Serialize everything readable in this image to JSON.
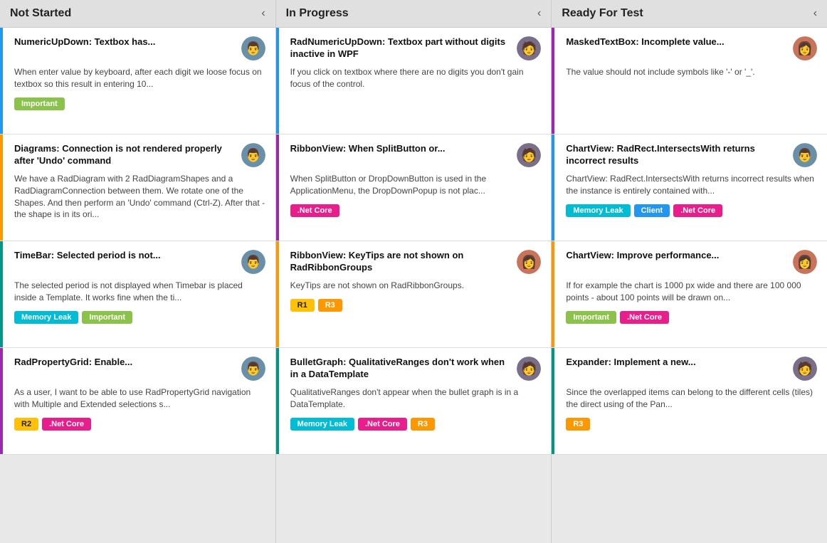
{
  "columns": [
    {
      "id": "not-started",
      "title": "Not Started",
      "arrow": "‹",
      "cards": [
        {
          "id": "card-1",
          "title": "NumericUpDown: Textbox has...",
          "body": "When enter value by keyboard, after each digit we loose focus on textbox so this result in entering 10...",
          "avatar": "m",
          "bar": "blue",
          "tags": [
            {
              "label": "Important",
              "type": "important"
            }
          ]
        },
        {
          "id": "card-2",
          "title": "Diagrams: Connection is not rendered properly after 'Undo' command",
          "body": "We have a RadDiagram with 2 RadDiagramShapes and a RadDiagramConnection between them. We rotate one of the Shapes. And then perform an 'Undo' command (Ctrl-Z). After that - the shape is in its ori...",
          "avatar": "m",
          "bar": "orange",
          "tags": []
        },
        {
          "id": "card-3",
          "title": "TimeBar: Selected period is not...",
          "body": "The selected period is not displayed when Timebar is placed inside a Template. It works fine when the ti...",
          "avatar": "m",
          "bar": "teal",
          "tags": [
            {
              "label": "Memory Leak",
              "type": "memory-leak"
            },
            {
              "label": "Important",
              "type": "important"
            }
          ]
        },
        {
          "id": "card-4",
          "title": "RadPropertyGrid: Enable...",
          "body": "As a user, I want to be able to use RadPropertyGrid navigation with Multiple and Extended selections s...",
          "avatar": "m",
          "bar": "purple",
          "tags": [
            {
              "label": "R2",
              "type": "r2"
            },
            {
              "label": ".Net Core",
              "type": "net-core"
            }
          ]
        }
      ]
    },
    {
      "id": "in-progress",
      "title": "In Progress",
      "arrow": "‹",
      "cards": [
        {
          "id": "card-5",
          "title": "RadNumericUpDown: Textbox part without digits inactive in WPF",
          "body": "If you click on textbox where there are no digits you don't gain focus of the control.",
          "avatar": "m2",
          "bar": "blue",
          "tags": []
        },
        {
          "id": "card-6",
          "title": "RibbonView: When SplitButton or...",
          "body": "When SplitButton or DropDownButton is used in the ApplicationMenu, the DropDownPopup is not plac...",
          "avatar": "m2",
          "bar": "purple",
          "tags": [
            {
              "label": ".Net Core",
              "type": "net-core"
            }
          ]
        },
        {
          "id": "card-7",
          "title": "RibbonView: KeyTips are not shown on RadRibbonGroups",
          "body": "KeyTips are not shown on RadRibbonGroups.",
          "avatar": "f",
          "bar": "orange",
          "tags": [
            {
              "label": "R1",
              "type": "r1"
            },
            {
              "label": "R3",
              "type": "r3"
            }
          ]
        },
        {
          "id": "card-8",
          "title": "BulletGraph: QualitativeRanges don't work when in a DataTemplate",
          "body": "QualitativeRanges don't appear when the bullet graph is in a DataTemplate.",
          "avatar": "m2",
          "bar": "teal",
          "tags": [
            {
              "label": "Memory Leak",
              "type": "memory-leak"
            },
            {
              "label": ".Net Core",
              "type": "net-core"
            },
            {
              "label": "R3",
              "type": "r3"
            }
          ]
        }
      ]
    },
    {
      "id": "ready-for-test",
      "title": "Ready For Test",
      "arrow": "‹",
      "cards": [
        {
          "id": "card-9",
          "title": "MaskedTextBox: Incomplete value...",
          "body": "The value should not include symbols like '-' or '_'.",
          "avatar": "f",
          "bar": "purple",
          "tags": []
        },
        {
          "id": "card-10",
          "title": "ChartView: RadRect.IntersectsWith returns incorrect results",
          "body": "ChartView: RadRect.IntersectsWith returns incorrect results when the instance is entirely contained with...",
          "avatar": "m",
          "bar": "blue",
          "tags": [
            {
              "label": "Memory Leak",
              "type": "memory-leak"
            },
            {
              "label": "Client",
              "type": "client"
            },
            {
              "label": ".Net Core",
              "type": "net-core"
            }
          ]
        },
        {
          "id": "card-11",
          "title": "ChartView: Improve performance...",
          "body": "If for example the chart is 1000 px wide and there are 100 000 points - about 100 points will be drawn on...",
          "avatar": "f",
          "bar": "orange",
          "tags": [
            {
              "label": "Important",
              "type": "important"
            },
            {
              "label": ".Net Core",
              "type": "net-core"
            }
          ]
        },
        {
          "id": "card-12",
          "title": "Expander: Implement a new...",
          "body": "Since the overlapped items can belong to the different cells (tiles) the direct using of the Pan...",
          "avatar": "m2",
          "bar": "teal",
          "tags": [
            {
              "label": "R3",
              "type": "r3"
            }
          ]
        }
      ]
    }
  ]
}
